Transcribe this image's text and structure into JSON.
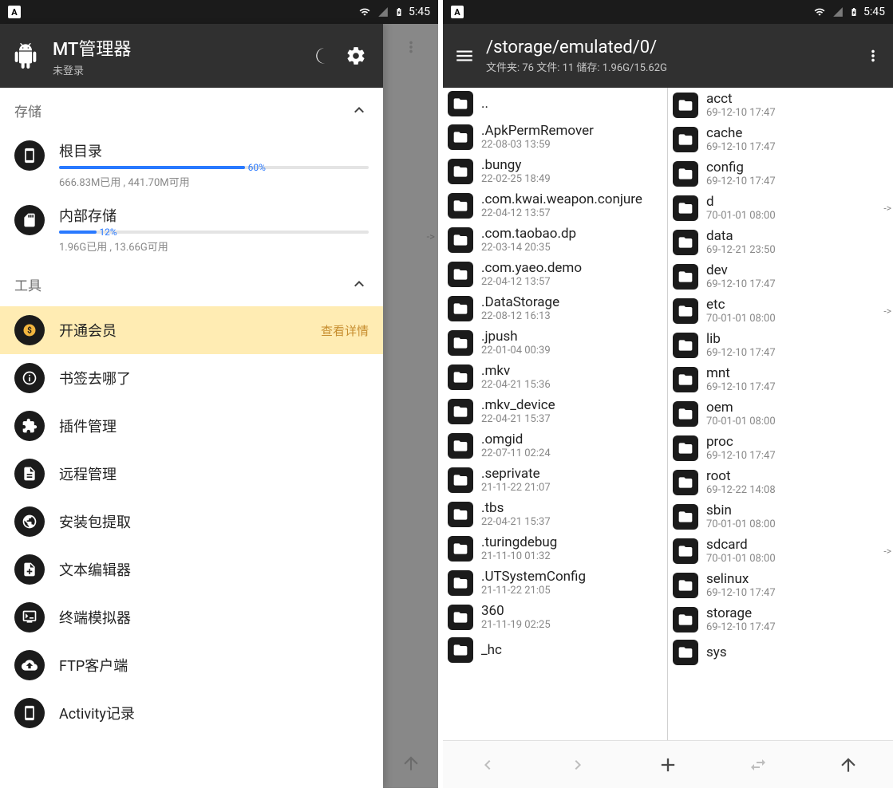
{
  "status": {
    "a": "A",
    "time": "5:45"
  },
  "left": {
    "title": "MT管理器",
    "subtitle": "未登录",
    "sections": {
      "storage": {
        "header": "存储",
        "items": [
          {
            "name": "根目录",
            "pct": 60,
            "pctText": "60%",
            "sub": "666.83M已用 , 441.70M可用"
          },
          {
            "name": "内部存储",
            "pct": 12,
            "pctText": "12%",
            "sub": "1.96G已用 , 13.66G可用"
          }
        ]
      },
      "tools": {
        "header": "工具",
        "vip": {
          "label": "开通会员",
          "badge": "查看详情"
        },
        "items": [
          {
            "label": "书签去哪了"
          },
          {
            "label": "插件管理"
          },
          {
            "label": "远程管理"
          },
          {
            "label": "安装包提取"
          },
          {
            "label": "文本编辑器"
          },
          {
            "label": "终端模拟器"
          },
          {
            "label": "FTP客户端"
          },
          {
            "label": "Activity记录"
          }
        ]
      }
    }
  },
  "right": {
    "path": "/storage/emulated/0/",
    "stats": "文件夹: 76 文件: 11 储存: 1.96G/15.62G",
    "paneL": [
      {
        "name": "..",
        "date": ""
      },
      {
        "name": ".ApkPermRemover",
        "date": "22-08-03 13:59"
      },
      {
        "name": ".bungy",
        "date": "22-02-25 18:49"
      },
      {
        "name": ".com.kwai.weapon.conjure",
        "date": "22-04-12 13:57"
      },
      {
        "name": ".com.taobao.dp",
        "date": "22-03-14 20:35"
      },
      {
        "name": ".com.yaeo.demo",
        "date": "22-04-12 13:57"
      },
      {
        "name": ".DataStorage",
        "date": "22-08-12 16:13"
      },
      {
        "name": ".jpush",
        "date": "22-01-04 00:39"
      },
      {
        "name": ".mkv",
        "date": "22-04-21 15:36"
      },
      {
        "name": ".mkv_device",
        "date": "22-04-21 15:37"
      },
      {
        "name": ".omgid",
        "date": "22-07-11 02:24"
      },
      {
        "name": ".seprivate",
        "date": "21-11-22 21:07"
      },
      {
        "name": ".tbs",
        "date": "22-04-21 15:37"
      },
      {
        "name": ".turingdebug",
        "date": "21-11-10 01:32"
      },
      {
        "name": ".UTSystemConfig",
        "date": "21-11-22 21:05"
      },
      {
        "name": "360",
        "date": "21-11-19 02:25"
      },
      {
        "name": "_hc",
        "date": ""
      }
    ],
    "paneR": [
      {
        "name": "acct",
        "date": "69-12-10 17:47"
      },
      {
        "name": "cache",
        "date": "69-12-10 17:47"
      },
      {
        "name": "config",
        "date": "69-12-10 17:47"
      },
      {
        "name": "d",
        "date": "70-01-01 08:00",
        "link": true
      },
      {
        "name": "data",
        "date": "69-12-21 23:50"
      },
      {
        "name": "dev",
        "date": "69-12-10 17:47"
      },
      {
        "name": "etc",
        "date": "70-01-01 08:00",
        "link": true
      },
      {
        "name": "lib",
        "date": "69-12-10 17:47"
      },
      {
        "name": "mnt",
        "date": "69-12-10 17:47"
      },
      {
        "name": "oem",
        "date": "70-01-01 08:00"
      },
      {
        "name": "proc",
        "date": "69-12-10 17:47"
      },
      {
        "name": "root",
        "date": "69-12-22 14:08"
      },
      {
        "name": "sbin",
        "date": "70-01-01 08:00"
      },
      {
        "name": "sdcard",
        "date": "70-01-01 08:00",
        "link": true
      },
      {
        "name": "selinux",
        "date": "69-12-10 17:47"
      },
      {
        "name": "storage",
        "date": "69-12-10 17:47"
      },
      {
        "name": "sys",
        "date": ""
      }
    ]
  }
}
